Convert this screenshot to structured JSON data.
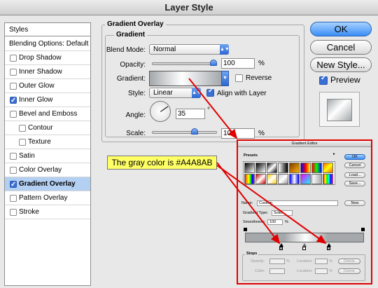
{
  "window": {
    "title": "Layer Style"
  },
  "styles_panel": {
    "header": "Styles",
    "items": [
      {
        "label": "Blending Options: Default",
        "checkbox": false,
        "checked": false,
        "indent": 0,
        "selected": false,
        "bold": false
      },
      {
        "label": "Drop Shadow",
        "checkbox": true,
        "checked": false,
        "indent": 0,
        "selected": false,
        "bold": false
      },
      {
        "label": "Inner Shadow",
        "checkbox": true,
        "checked": false,
        "indent": 0,
        "selected": false,
        "bold": false
      },
      {
        "label": "Outer Glow",
        "checkbox": true,
        "checked": false,
        "indent": 0,
        "selected": false,
        "bold": false
      },
      {
        "label": "Inner Glow",
        "checkbox": true,
        "checked": true,
        "indent": 0,
        "selected": false,
        "bold": false
      },
      {
        "label": "Bevel and Emboss",
        "checkbox": true,
        "checked": false,
        "indent": 0,
        "selected": false,
        "bold": false
      },
      {
        "label": "Contour",
        "checkbox": true,
        "checked": false,
        "indent": 1,
        "selected": false,
        "bold": false
      },
      {
        "label": "Texture",
        "checkbox": true,
        "checked": false,
        "indent": 1,
        "selected": false,
        "bold": false
      },
      {
        "label": "Satin",
        "checkbox": true,
        "checked": false,
        "indent": 0,
        "selected": false,
        "bold": false
      },
      {
        "label": "Color Overlay",
        "checkbox": true,
        "checked": false,
        "indent": 0,
        "selected": false,
        "bold": false
      },
      {
        "label": "Gradient Overlay",
        "checkbox": true,
        "checked": true,
        "indent": 0,
        "selected": true,
        "bold": true
      },
      {
        "label": "Pattern Overlay",
        "checkbox": true,
        "checked": false,
        "indent": 0,
        "selected": false,
        "bold": false
      },
      {
        "label": "Stroke",
        "checkbox": true,
        "checked": false,
        "indent": 0,
        "selected": false,
        "bold": false
      }
    ]
  },
  "gradient_overlay": {
    "group_title": "Gradient Overlay",
    "subgroup_title": "Gradient",
    "blend_mode_label": "Blend Mode:",
    "blend_mode_value": "Normal",
    "opacity_label": "Opacity:",
    "opacity_value": "100",
    "opacity_unit": "%",
    "opacity_level": 1.0,
    "gradient_label": "Gradient:",
    "reverse_label": "Reverse",
    "reverse_checked": false,
    "style_label": "Style:",
    "style_value": "Linear",
    "align_label": "Align with Layer",
    "align_checked": true,
    "angle_label": "Angle:",
    "angle_value": "35",
    "angle_unit": "°",
    "angle_degrees": 35,
    "scale_label": "Scale:",
    "scale_value": "100",
    "scale_unit": "%",
    "scale_level": 0.67
  },
  "buttons": {
    "ok": "OK",
    "cancel": "Cancel",
    "new_style": "New Style...",
    "preview": "Preview",
    "preview_checked": true
  },
  "tooltip": {
    "text": "The gray color is #A4A8AB"
  },
  "gradient_editor": {
    "title": "Gradient Editor",
    "presets_label": "Presets",
    "ok": "OK",
    "cancel": "Cancel",
    "load": "Load...",
    "save": "Save...",
    "name_label": "Name:",
    "name_value": "Custom",
    "new_button": "New",
    "type_label": "Gradient Type:",
    "type_value": "Solid",
    "smoothness_label": "Smoothness:",
    "smoothness_value": "100",
    "smoothness_unit": "%",
    "stops_label": "Stops",
    "opacity_label": "Opacity:",
    "opacity_unit": "%",
    "location_label": "Location:",
    "location_unit": "%",
    "delete_label": "Delete",
    "color_label": "Color:",
    "location2_label": "Location:",
    "location2_unit": "%",
    "delete2_label": "Delete"
  },
  "colors": {
    "gray_stop": "#A4A8AB",
    "highlight": "#b3d0f2",
    "accent_red": "#e10000",
    "tooltip_bg": "#ffff66"
  }
}
